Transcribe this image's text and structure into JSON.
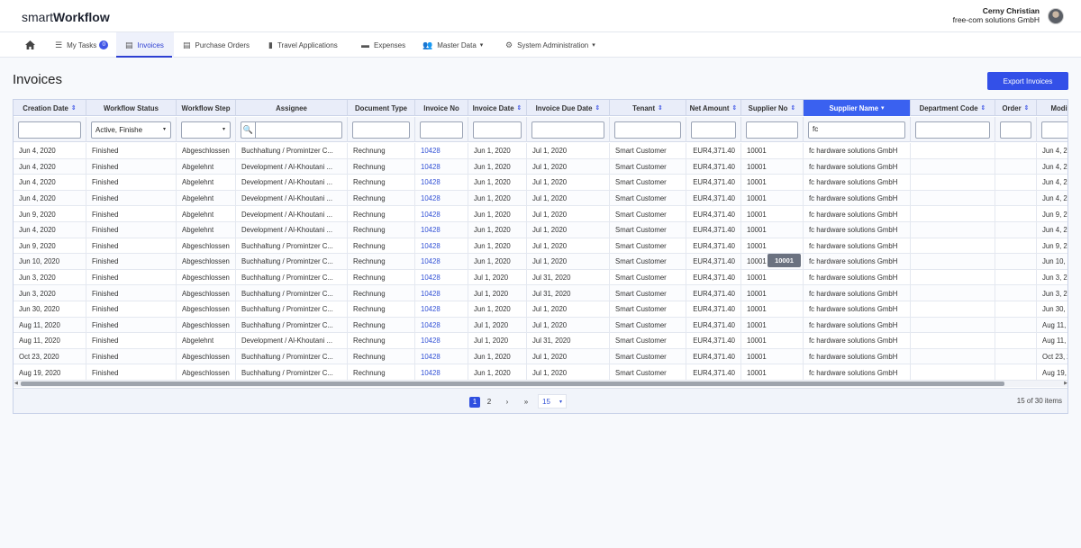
{
  "app": {
    "logo_prefix": "smart",
    "logo_bold": "Workflow"
  },
  "user": {
    "name": "Cerny Christian",
    "company": "free-com solutions GmbH"
  },
  "nav": {
    "home_icon": "home-icon",
    "items": [
      {
        "label": "My Tasks",
        "icon": "tasks-icon",
        "badge": "0"
      },
      {
        "label": "Invoices",
        "icon": "document-icon",
        "active": true
      },
      {
        "label": "Purchase Orders",
        "icon": "document-icon"
      },
      {
        "label": "Travel Applications",
        "icon": "book-icon"
      },
      {
        "label": "Expenses",
        "icon": "wallet-icon"
      },
      {
        "label": "Master Data",
        "icon": "users-icon",
        "dropdown": true
      },
      {
        "label": "System Administration",
        "icon": "gear-icon",
        "dropdown": true
      }
    ]
  },
  "page": {
    "title": "Invoices",
    "export_label": "Export Invoices"
  },
  "columns": [
    {
      "label": "Creation Date",
      "sortable": true
    },
    {
      "label": "Workflow Status"
    },
    {
      "label": "Workflow Step"
    },
    {
      "label": "Assignee"
    },
    {
      "label": "Document Type"
    },
    {
      "label": "Invoice No"
    },
    {
      "label": "Invoice Date",
      "sortable": true
    },
    {
      "label": "Invoice Due Date",
      "sortable": true
    },
    {
      "label": "Tenant",
      "sortable": true
    },
    {
      "label": "Net Amount",
      "sortable": true
    },
    {
      "label": "Supplier No",
      "sortable": true
    },
    {
      "label": "Supplier Name",
      "sortable": true,
      "selected": true
    },
    {
      "label": "Department Code",
      "sortable": true
    },
    {
      "label": "Order",
      "sortable": true
    },
    {
      "label": "Modified"
    }
  ],
  "filters": {
    "workflow_status": "Active, Finishe",
    "workflow_step": "",
    "supplier_name": "fc"
  },
  "rows": [
    [
      "Jun 4, 2020",
      "Finished",
      "Abgeschlossen",
      "Buchhaltung / Promintzer C...",
      "Rechnung",
      "10428",
      "Jun 1, 2020",
      "Jul 1, 2020",
      "Smart Customer",
      "EUR4,371.40",
      "10001",
      "fc hardware solutions GmbH",
      "",
      "",
      "Jun 4, 2"
    ],
    [
      "Jun 4, 2020",
      "Finished",
      "Abgelehnt",
      "Development / Al-Khoutani ...",
      "Rechnung",
      "10428",
      "Jun 1, 2020",
      "Jul 1, 2020",
      "Smart Customer",
      "EUR4,371.40",
      "10001",
      "fc hardware solutions GmbH",
      "",
      "",
      "Jun 4, 2"
    ],
    [
      "Jun 4, 2020",
      "Finished",
      "Abgelehnt",
      "Development / Al-Khoutani ...",
      "Rechnung",
      "10428",
      "Jun 1, 2020",
      "Jul 1, 2020",
      "Smart Customer",
      "EUR4,371.40",
      "10001",
      "fc hardware solutions GmbH",
      "",
      "",
      "Jun 4, 2"
    ],
    [
      "Jun 4, 2020",
      "Finished",
      "Abgelehnt",
      "Development / Al-Khoutani ...",
      "Rechnung",
      "10428",
      "Jun 1, 2020",
      "Jul 1, 2020",
      "Smart Customer",
      "EUR4,371.40",
      "10001",
      "fc hardware solutions GmbH",
      "",
      "",
      "Jun 4, 2"
    ],
    [
      "Jun 9, 2020",
      "Finished",
      "Abgelehnt",
      "Development / Al-Khoutani ...",
      "Rechnung",
      "10428",
      "Jun 1, 2020",
      "Jul 1, 2020",
      "Smart Customer",
      "EUR4,371.40",
      "10001",
      "fc hardware solutions GmbH",
      "",
      "",
      "Jun 9, 2("
    ],
    [
      "Jun 4, 2020",
      "Finished",
      "Abgelehnt",
      "Development / Al-Khoutani ...",
      "Rechnung",
      "10428",
      "Jun 1, 2020",
      "Jul 1, 2020",
      "Smart Customer",
      "EUR4,371.40",
      "10001",
      "fc hardware solutions GmbH",
      "",
      "",
      "Jun 4, 2"
    ],
    [
      "Jun 9, 2020",
      "Finished",
      "Abgeschlossen",
      "Buchhaltung / Promintzer C...",
      "Rechnung",
      "10428",
      "Jun 1, 2020",
      "Jul 1, 2020",
      "Smart Customer",
      "EUR4,371.40",
      "10001",
      "fc hardware solutions GmbH",
      "",
      "",
      "Jun 9, 2("
    ],
    [
      "Jun 10, 2020",
      "Finished",
      "Abgeschlossen",
      "Buchhaltung / Promintzer C...",
      "Rechnung",
      "10428",
      "Jun 1, 2020",
      "Jul 1, 2020",
      "Smart Customer",
      "EUR4,371.40",
      "10001",
      "fc hardware solutions GmbH",
      "",
      "",
      "Jun 10, :"
    ],
    [
      "Jun 3, 2020",
      "Finished",
      "Abgeschlossen",
      "Buchhaltung / Promintzer C...",
      "Rechnung",
      "10428",
      "Jul 1, 2020",
      "Jul 31, 2020",
      "Smart Customer",
      "EUR4,371.40",
      "10001",
      "fc hardware solutions GmbH",
      "",
      "",
      "Jun 3, 2"
    ],
    [
      "Jun 3, 2020",
      "Finished",
      "Abgeschlossen",
      "Buchhaltung / Promintzer C...",
      "Rechnung",
      "10428",
      "Jul 1, 2020",
      "Jul 31, 2020",
      "Smart Customer",
      "EUR4,371.40",
      "10001",
      "fc hardware solutions GmbH",
      "",
      "",
      "Jun 3, 2"
    ],
    [
      "Jun 30, 2020",
      "Finished",
      "Abgeschlossen",
      "Buchhaltung / Promintzer C...",
      "Rechnung",
      "10428",
      "Jun 1, 2020",
      "Jul 1, 2020",
      "Smart Customer",
      "EUR4,371.40",
      "10001",
      "fc hardware solutions GmbH",
      "",
      "",
      "Jun 30,"
    ],
    [
      "Aug 11, 2020",
      "Finished",
      "Abgeschlossen",
      "Buchhaltung / Promintzer C...",
      "Rechnung",
      "10428",
      "Jul 1, 2020",
      "Jul 1, 2020",
      "Smart Customer",
      "EUR4,371.40",
      "10001",
      "fc hardware solutions GmbH",
      "",
      "",
      "Aug 11, 2"
    ],
    [
      "Aug 11, 2020",
      "Finished",
      "Abgelehnt",
      "Development / Al-Khoutani ...",
      "Rechnung",
      "10428",
      "Jul 1, 2020",
      "Jul 31, 2020",
      "Smart Customer",
      "EUR4,371.40",
      "10001",
      "fc hardware solutions GmbH",
      "",
      "",
      "Aug 11, 2"
    ],
    [
      "Oct 23, 2020",
      "Finished",
      "Abgeschlossen",
      "Buchhaltung / Promintzer C...",
      "Rechnung",
      "10428",
      "Jun 1, 2020",
      "Jul 1, 2020",
      "Smart Customer",
      "EUR4,371.40",
      "10001",
      "fc hardware solutions GmbH",
      "",
      "",
      "Oct 23, 2"
    ],
    [
      "Aug 19, 2020",
      "Finished",
      "Abgeschlossen",
      "Buchhaltung / Promintzer C...",
      "Rechnung",
      "10428",
      "Jun 1, 2020",
      "Jul 1, 2020",
      "Smart Customer",
      "EUR4,371.40",
      "10001",
      "fc hardware solutions GmbH",
      "",
      "",
      "Aug 19, 2"
    ]
  ],
  "tooltip": "10001",
  "pager": {
    "pages": [
      "1",
      "2"
    ],
    "current": "1",
    "next": "›",
    "last": "»",
    "page_size": "15",
    "info": "15 of 30 items"
  },
  "colors": {
    "accent": "#3350e8",
    "selected_header": "#3a61f0",
    "link": "#3352d6"
  }
}
